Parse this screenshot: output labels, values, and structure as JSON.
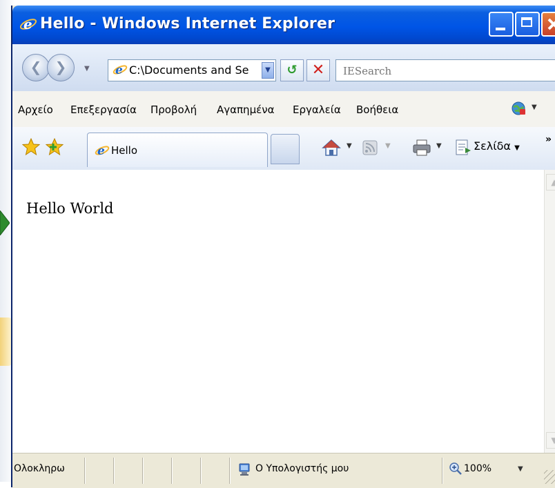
{
  "window": {
    "title": "Hello - Windows Internet Explorer"
  },
  "address": {
    "value": "C:\\Documents and Se"
  },
  "search": {
    "placeholder": "IESearch"
  },
  "menu": {
    "items": [
      "Αρχείο",
      "Επεξεργασία",
      "Προβολή",
      "Αγαπημένα",
      "Εργαλεία",
      "Βοήθεια"
    ]
  },
  "tab": {
    "label": "Hello"
  },
  "command": {
    "page_label": "Σελίδα",
    "more": "»"
  },
  "content": {
    "text": "Hello World"
  },
  "status": {
    "text": "Ολοκληρω",
    "zone": "Ο Υπολογιστής μου",
    "zoom": "100%"
  },
  "icons": {
    "app": "ie-icon",
    "back": "back-icon",
    "forward": "forward-icon",
    "refresh": "refresh-icon",
    "stop": "stop-icon",
    "favorites": "favorites-star-icon",
    "add_favorites": "add-favorites-icon",
    "home": "home-icon",
    "feeds": "feeds-icon",
    "print": "print-icon",
    "page": "page-icon",
    "zone": "computer-zone-icon",
    "zoom": "zoom-icon"
  },
  "colors": {
    "titlebar": "#0055e6",
    "close_button": "#c8402a",
    "refresh": "#2d9a2d",
    "stop": "#d0201c"
  }
}
